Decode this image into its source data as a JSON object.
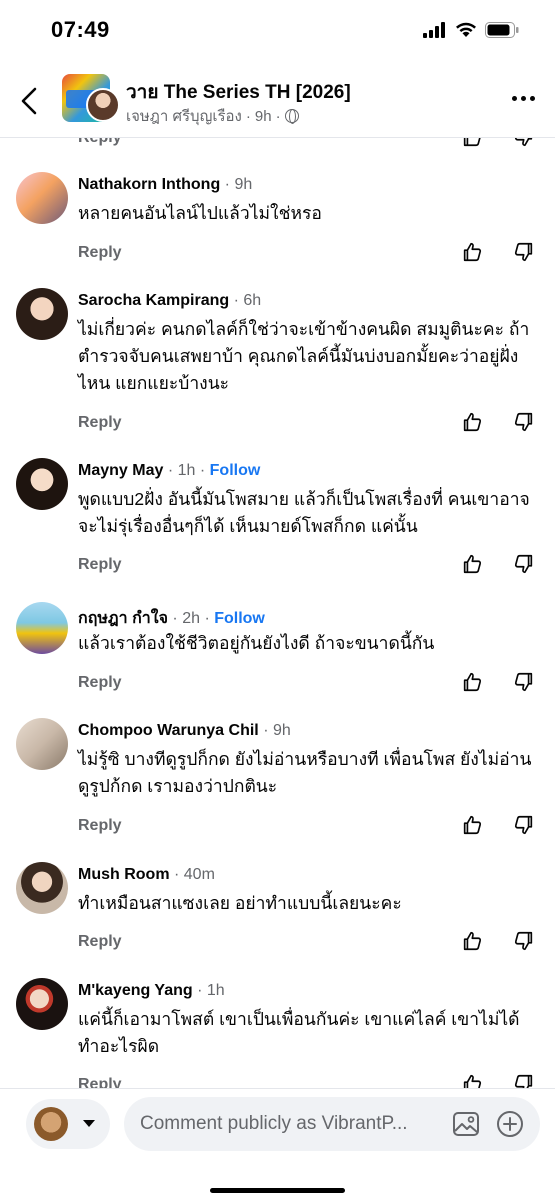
{
  "status_bar": {
    "time": "07:49"
  },
  "header": {
    "title": "วาย The Series TH [2026]",
    "author": "เจษฎา ศรีบุญเรือง",
    "time": "9h",
    "separator": "·"
  },
  "reply_label": "Reply",
  "follow_label": "Follow",
  "comments": [
    {
      "name": "Nathakorn Inthong",
      "time": "9h",
      "show_follow": false,
      "text": "หลายคนอันไลน์ไปแล้วไม่ใช่หรอ"
    },
    {
      "name": "Sarocha Kampirang",
      "time": "6h",
      "show_follow": false,
      "text": "ไม่เกี่ยวค่ะ คนกดไลค์ก็ใช่ว่าจะเข้าข้างคนผิด สมมูตินะคะ ถ้าตำรวจจับคนเสพยาบ้า คุณกดไลค์นี้มันบ่งบอกมั้ยคะว่าอยู่ฝั่งไหน แยกแยะบ้างนะ"
    },
    {
      "name": "Mayny May",
      "time": "1h",
      "show_follow": true,
      "text": "พูดแบบ2ฝั่ง อันนี้มันโพสมาย แล้วก็เป็นโพสเรื่องที่ คนเขาอาจจะไม่รุ่เรื่องอื่นๆก็ได้ เห็นมายด์โพสก็กด แค่นั้น"
    },
    {
      "name": "กฤษฎา กำใจ",
      "time": "2h",
      "show_follow": true,
      "text": "แล้วเราต้องใช้ชีวิตอยู่กันยังไงดี ถ้าจะขนาดนี้กัน"
    },
    {
      "name": "Chompoo Warunya Chil",
      "time": "9h",
      "show_follow": false,
      "text": "ไม่รู้ซิ บางทีดูรูปก็กด ยังไม่อ่านหรือบางที เพื่อนโพส ยังไม่อ่านดูรูปก้กด เรามองว่าปกตินะ"
    },
    {
      "name": "Mush Room",
      "time": "40m",
      "show_follow": false,
      "text": "ทำเหมือนสาแซงเลย อย่าทำแบบนี้เลยนะคะ"
    },
    {
      "name": "M'kayeng Yang",
      "time": "1h",
      "show_follow": false,
      "text": "แค่นี้ก็เอามาโพสต์ เขาเป็นเพื่อนกันค่ะ เขาแค่ไลค์ เขาไม่ได้ทำอะไรผิด"
    }
  ],
  "composer": {
    "placeholder": "Comment publicly as VibrantP..."
  },
  "colors": {
    "accent": "#1877f2",
    "muted": "#65676b",
    "text": "#050505",
    "input_bg": "#f0f2f5"
  }
}
